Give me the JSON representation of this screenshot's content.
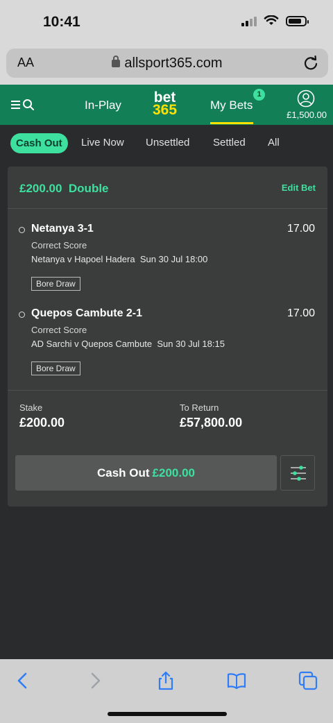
{
  "status": {
    "time": "10:41"
  },
  "browser": {
    "text_size_label": "AA",
    "url": "allsport365.com"
  },
  "header": {
    "nav_inplay": "In-Play",
    "logo_top": "bet",
    "logo_bottom": "365",
    "nav_mybets": "My Bets",
    "mybets_count": "1",
    "balance": "£1,500.00"
  },
  "tabs": [
    "Cash Out",
    "Live Now",
    "Unsettled",
    "Settled",
    "All"
  ],
  "bet": {
    "stake_and_type": "£200.00  Double",
    "edit_label": "Edit Bet",
    "selections": [
      {
        "name": "Netanya 3-1",
        "odds": "17.00",
        "market": "Correct Score",
        "event": "Netanya v Hapoel Hadera  Sun 30 Jul 18:00",
        "tag": "Bore Draw"
      },
      {
        "name": "Quepos Cambute 2-1",
        "odds": "17.00",
        "market": "Correct Score",
        "event": "AD Sarchi v Quepos Cambute  Sun 30 Jul 18:15",
        "tag": "Bore Draw"
      }
    ],
    "stake_label": "Stake",
    "stake_value": "£200.00",
    "return_label": "To Return",
    "return_value": "£57,800.00",
    "cashout_label": "Cash Out",
    "cashout_amount": "£200.00"
  },
  "colors": {
    "brand_green": "#137f56",
    "accent_mint": "#3ee0a0",
    "logo_yellow": "#ffe100",
    "ios_blue": "#2f7cf6"
  },
  "icons": {
    "header": [
      "menu-icon",
      "search-icon",
      "account-icon"
    ],
    "toolbar": [
      "back-icon",
      "forward-icon",
      "share-icon",
      "bookmarks-icon",
      "tabs-icon"
    ]
  }
}
